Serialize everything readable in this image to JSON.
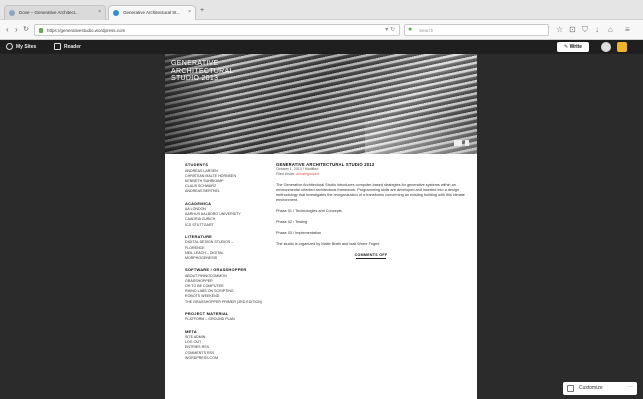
{
  "browser": {
    "tabs": [
      {
        "label": "Dove – Generative Architect...",
        "active": false
      },
      {
        "label": "Generative Architectural St...",
        "active": true
      }
    ],
    "url": "https://generativestudio.wordpress.com",
    "search_placeholder": "Search"
  },
  "wp_bar": {
    "my_sites": "My Sites",
    "reader": "Reader",
    "write": "Write"
  },
  "site": {
    "title_lines": [
      "GENERATIVE",
      "ARCHITECTURAL",
      "STUDIO 2013"
    ]
  },
  "sidebar": [
    {
      "heading": "STUDENTS",
      "items": [
        "Andreas Larsen",
        "Christian Malte Hornsen",
        "Kenneth Suhrkamp",
        "Claus Schwarz",
        "Andreas Berthel"
      ]
    },
    {
      "heading": "ACADEMICA",
      "items": [
        "AA London",
        "Aarhus Aalborg University",
        "CAADRIA Zurich",
        "ICD Stuttgart"
      ]
    },
    {
      "heading": "LITERATURE",
      "items": [
        "Digital Design Studios –",
        "Florence",
        "Neil Leach – Digital",
        "Morphogenesis"
      ]
    },
    {
      "heading": "SOFTWARE / GRASSHOPPER",
      "items": [
        "About Rhinocommon",
        "Grasshopper",
        "Oh to be Computer",
        "Rhino Labs on Scripting",
        "Robots Weekend",
        "The Grasshopper Primer (3rd Edition)"
      ]
    },
    {
      "heading": "PROJECT MATERIAL",
      "items": [
        "Platform – Ground Plan"
      ]
    },
    {
      "heading": "META",
      "items": [
        "Site Admin",
        "Log Out",
        "Entries RSS",
        "Comments RSS",
        "WordPress.com"
      ]
    }
  ],
  "post": {
    "title": "GENERATIVE ARCHITECTURAL STUDIO 2013",
    "meta_date": "October 1, 2013 / Modified",
    "meta_filed": "Filed Under",
    "meta_category": "Uncategorized",
    "paragraphs": [
      "The Generative Architectural Studio introduces computer-based strategies for generative systems within an environmental oriented architectural framework. Programming skills are developed and inserted into a design methodology that investigates the reorganization of a transforms concerning an existing building with this climate environment.",
      "Phase 01 / Technologies and Concepts",
      "Phase 02 / Testing",
      "Phase 03 / Implementation",
      "The studio is organized by Malte Brath and Isak Worre Foged"
    ],
    "comments": "COMMENTS OFF"
  },
  "customize": "Customize"
}
